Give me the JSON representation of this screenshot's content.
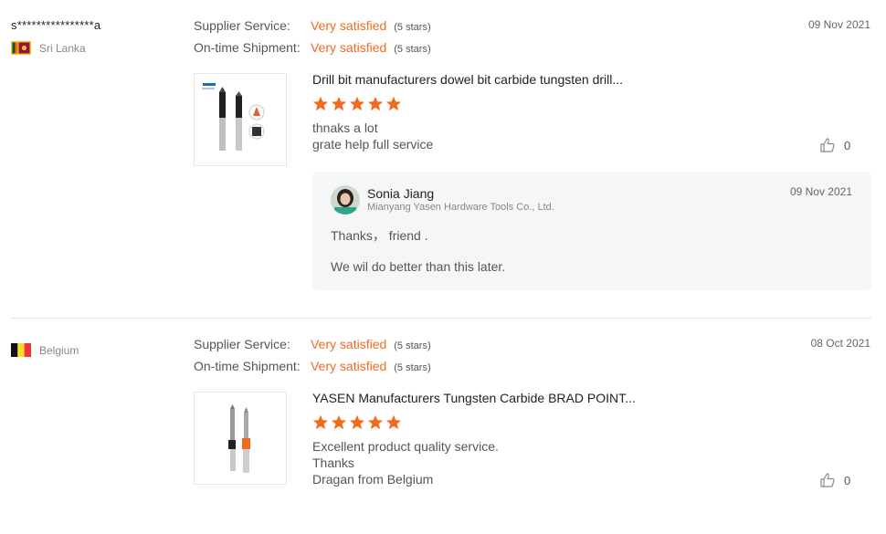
{
  "reviews": [
    {
      "buyer": "s****************a",
      "country": "Sri Lanka",
      "supplier_service_label": "Supplier Service:",
      "supplier_service_value": "Very satisfied",
      "supplier_service_stars": "(5 stars)",
      "shipment_label": "On-time Shipment:",
      "shipment_value": "Very satisfied",
      "shipment_stars": "(5 stars)",
      "date": "09 Nov 2021",
      "product_title": "Drill bit manufacturers dowel bit carbide tungsten drill...",
      "rating": 5,
      "comment_lines": [
        "thnaks a lot",
        "grate  help full service"
      ],
      "likes": "0",
      "reply": {
        "name": "Sonia Jiang",
        "company": "Mianyang Yasen Hardware Tools Co., Ltd.",
        "date": "09 Nov 2021",
        "lines": [
          "Thanks，  friend .",
          "We wil do better than this later."
        ]
      }
    },
    {
      "buyer": "",
      "country": "Belgium",
      "supplier_service_label": "Supplier Service:",
      "supplier_service_value": "Very satisfied",
      "supplier_service_stars": "(5 stars)",
      "shipment_label": "On-time Shipment:",
      "shipment_value": "Very satisfied",
      "shipment_stars": "(5 stars)",
      "date": "08 Oct 2021",
      "product_title": "YASEN Manufacturers Tungsten Carbide BRAD POINT...",
      "rating": 5,
      "comment_lines": [
        "Excellent product quality service.",
        "Thanks",
        "Dragan from Belgium"
      ],
      "likes": "0"
    }
  ],
  "colors": {
    "accent": "#f26b1d",
    "star": "#f26b1d",
    "reply_bg": "#f5f6f8"
  }
}
